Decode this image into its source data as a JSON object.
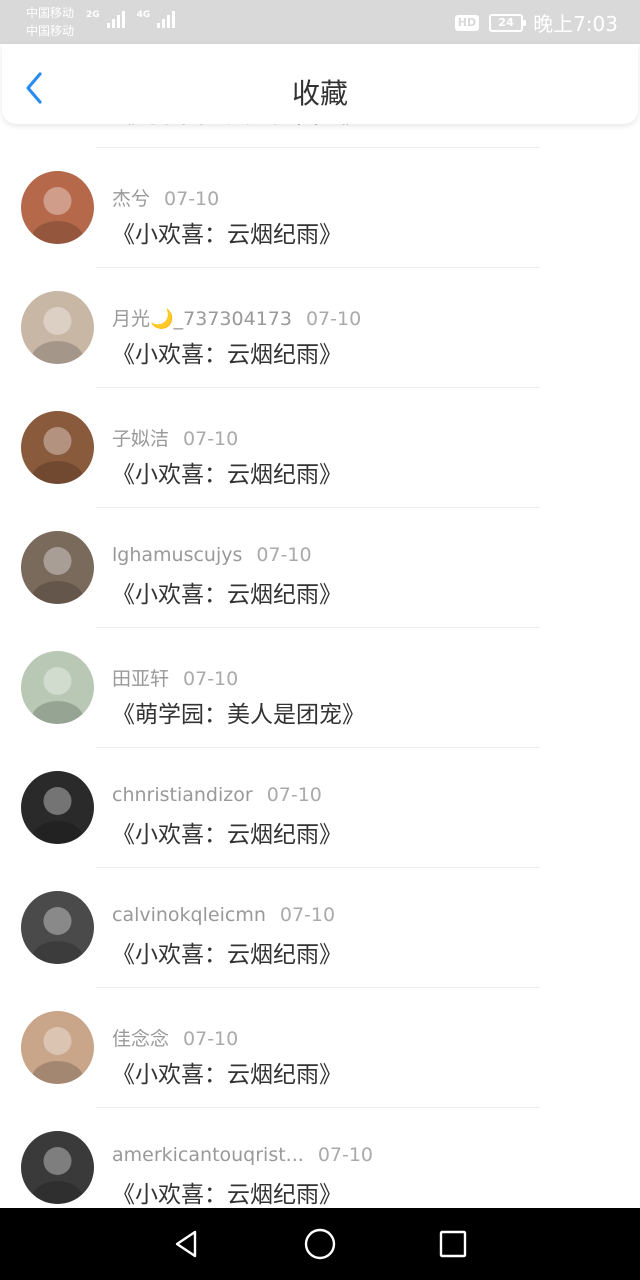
{
  "status_bar": {
    "carrier_1": "中国移动",
    "carrier_2": "中国移动",
    "net_1": "2G",
    "net_2": "4G",
    "hd": "HD",
    "battery": "24",
    "time": "晚上7:03"
  },
  "header": {
    "title": "收藏",
    "back_icon": "chevron-left-icon",
    "accent_color": "#2b8bf0"
  },
  "items": [
    {
      "user": "",
      "date": "",
      "book": "《萌学园：美人是团宠》",
      "avatar_color": "#f6dcd8"
    },
    {
      "user": "杰兮",
      "date": "07-10",
      "book": "《小欢喜：云烟纪雨》",
      "avatar_color": "#b5694a"
    },
    {
      "user": "月光🌙_737304173",
      "date": "07-10",
      "book": "《小欢喜：云烟纪雨》",
      "avatar_color": "#c9b7a6"
    },
    {
      "user": "子姒洁",
      "date": "07-10",
      "book": "《小欢喜：云烟纪雨》",
      "avatar_color": "#8a5a3c"
    },
    {
      "user": "lghamuscujys",
      "date": "07-10",
      "book": "《小欢喜：云烟纪雨》",
      "avatar_color": "#7a6a5c"
    },
    {
      "user": "田亚轩",
      "date": "07-10",
      "book": "《萌学园：美人是团宠》",
      "avatar_color": "#b8c8b4"
    },
    {
      "user": "chnristiandizor",
      "date": "07-10",
      "book": "《小欢喜：云烟纪雨》",
      "avatar_color": "#2a2a2a"
    },
    {
      "user": "calvinokqleicmn",
      "date": "07-10",
      "book": "《小欢喜：云烟纪雨》",
      "avatar_color": "#4a4a4a"
    },
    {
      "user": "佳念念",
      "date": "07-10",
      "book": "《小欢喜：云烟纪雨》",
      "avatar_color": "#c9a58a"
    },
    {
      "user": "amerkicantouqrist...",
      "date": "07-10",
      "book": "《小欢喜：云烟纪雨》",
      "avatar_color": "#3a3a3a"
    }
  ],
  "nav": {
    "back": "triangle-back-icon",
    "home": "circle-home-icon",
    "recent": "square-recent-icon"
  }
}
